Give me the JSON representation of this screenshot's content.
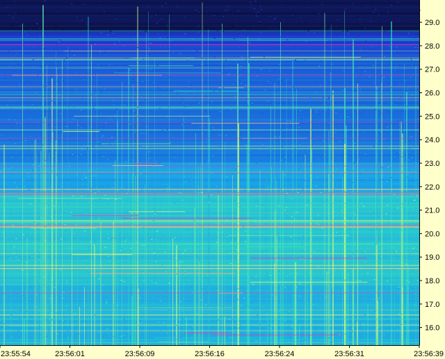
{
  "chart_data": {
    "type": "heatmap",
    "title": "",
    "xlabel": "",
    "ylabel": "",
    "x_ticks": [
      "23:55:54",
      "23:56:01",
      "23:56:09",
      "23:56:16",
      "23:56:24",
      "23:56:31",
      "23:56:39"
    ],
    "y_ticks": [
      29.0,
      28.0,
      27.0,
      26.0,
      25.0,
      24.0,
      23.0,
      22.0,
      21.0,
      20.0,
      19.0,
      18.0,
      17.0,
      16.0
    ],
    "y_tick_labels": [
      "29.0",
      "28.0",
      "27.0",
      "26.0",
      "25.0",
      "24.0",
      "23.0",
      "22.0",
      "21.0",
      "20.0",
      "19.0",
      "18.0",
      "17.0",
      "16.0"
    ],
    "ylim": [
      15.25,
      29.95
    ],
    "xlim": [
      "23:55:54",
      "23:56:39"
    ],
    "grid": false,
    "colors": {
      "panel_background": "#ffffcc",
      "axis_line": "#000000",
      "low": "#0a0a30",
      "mid_low": "#1a3fd0",
      "mid": "#1aa0e8",
      "mid_high": "#33e0c0",
      "high": "#ffff66",
      "peak": "#ff33aa"
    }
  }
}
